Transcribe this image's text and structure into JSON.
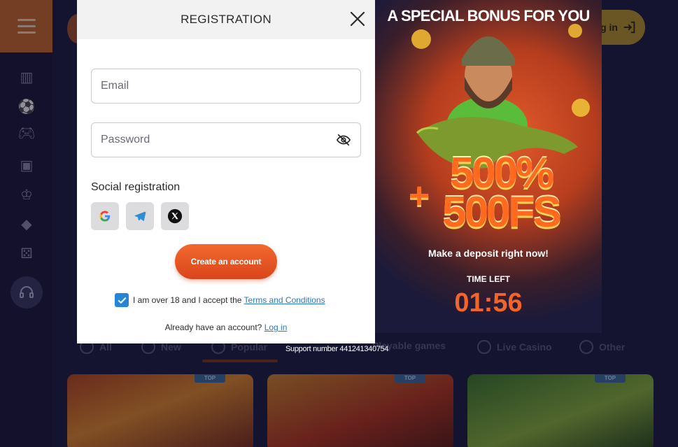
{
  "background": {
    "login_label": "Log in",
    "tabs": [
      {
        "label": "All",
        "icon": "grid-icon"
      },
      {
        "label": "New",
        "icon": "new-icon"
      },
      {
        "label": "Popular",
        "icon": "popular-icon"
      },
      {
        "label": "Playable games",
        "icon": "playable-icon"
      },
      {
        "label": "Live Casino",
        "icon": "live-icon"
      },
      {
        "label": "Other",
        "icon": "other-icon"
      }
    ],
    "game_badges": [
      "TOP",
      "TOP",
      "TOP"
    ],
    "support_number": "Support number 441241340754"
  },
  "modal": {
    "title": "REGISTRATION",
    "email_placeholder": "Email",
    "password_placeholder": "Password",
    "social_label": "Social registration",
    "social_buttons": [
      "google-icon",
      "telegram-icon",
      "x-icon"
    ],
    "create_button": "Create an account",
    "terms_prefix": "I am over 18 and I accept the ",
    "terms_link": "Terms and Conditions",
    "terms_checked": true,
    "login_prefix": "Already have an account? ",
    "login_link": "Log in"
  },
  "promo": {
    "title": "A SPECIAL BONUS FOR YOU",
    "bonus_plus": "+",
    "bonus_line1": "500%",
    "bonus_line2": "500FS",
    "subtitle": "Make a deposit right now!",
    "time_label": "TIME LEFT",
    "timer": "01:56"
  },
  "colors": {
    "accent_orange": "#e65a24",
    "link_blue": "#2a77c9",
    "checkbox_blue": "#2785d6",
    "background_navy": "#1d1c40"
  }
}
